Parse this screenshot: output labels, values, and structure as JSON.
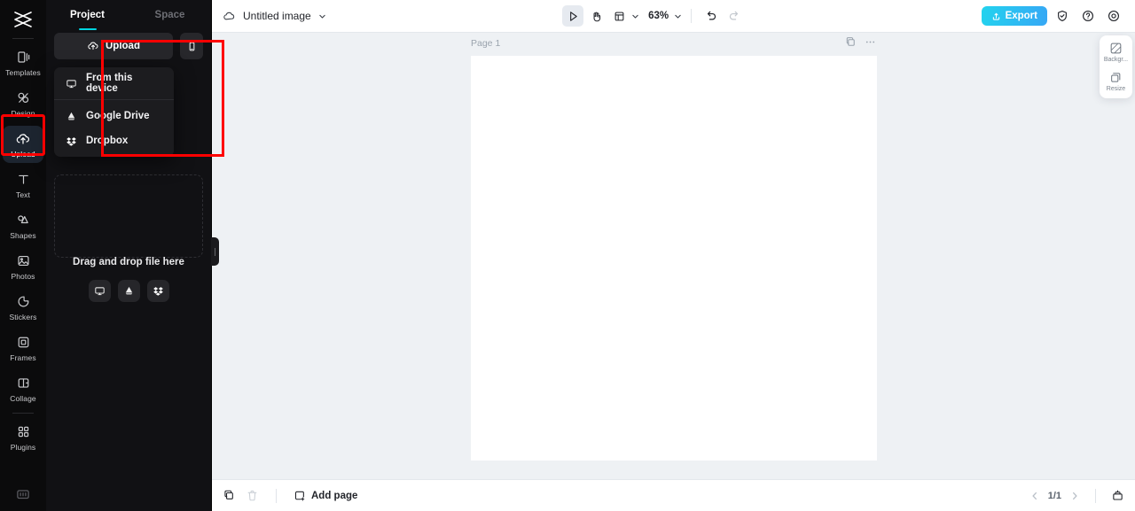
{
  "colors": {
    "rail_bg": "#0b0b0c",
    "panel_bg": "#111114",
    "accent_cyan": "#00d5e0",
    "export_from": "#23d3ee",
    "export_to": "#36a7f5",
    "highlight_red": "#ff0000",
    "canvas_bg": "#eef1f4",
    "active_item_bg": "#1d2530"
  },
  "rail": {
    "logo_name": "capcut-logo",
    "items": [
      {
        "label": "Templates",
        "icon": "templates-icon",
        "active": false
      },
      {
        "label": "Design",
        "icon": "design-icon",
        "active": false
      },
      {
        "label": "Upload",
        "icon": "upload-cloud-icon",
        "active": true
      },
      {
        "label": "Text",
        "icon": "text-icon",
        "active": false
      },
      {
        "label": "Shapes",
        "icon": "shapes-icon",
        "active": false
      },
      {
        "label": "Photos",
        "icon": "photos-icon",
        "active": false
      },
      {
        "label": "Stickers",
        "icon": "stickers-icon",
        "active": false
      },
      {
        "label": "Frames",
        "icon": "frames-icon",
        "active": false
      },
      {
        "label": "Collage",
        "icon": "collage-icon",
        "active": false
      },
      {
        "label": "Plugins",
        "icon": "plugins-icon",
        "active": false
      }
    ],
    "bottom_icon": "keyboard-icon"
  },
  "panel": {
    "tabs": [
      {
        "label": "Project",
        "active": true
      },
      {
        "label": "Space",
        "active": false
      }
    ],
    "upload_button": "Upload",
    "device_button_icon": "mobile-device-icon",
    "menu": [
      {
        "label": "From this device",
        "icon": "monitor-icon"
      },
      {
        "label": "Google Drive",
        "icon": "google-drive-icon"
      },
      {
        "label": "Dropbox",
        "icon": "dropbox-icon"
      }
    ],
    "dropzone": {
      "text": "Drag and drop file here",
      "buttons": [
        {
          "icon": "monitor-icon"
        },
        {
          "icon": "google-drive-icon"
        },
        {
          "icon": "dropbox-icon"
        }
      ]
    },
    "collapse_handle": "collapse-panel-handle"
  },
  "topbar": {
    "project_icon": "cloud-project-icon",
    "title": "Untitled image",
    "title_chevron": "chevron-down-icon",
    "tools": [
      {
        "icon": "select-cursor-icon",
        "selected": true
      },
      {
        "icon": "hand-pan-icon",
        "selected": false
      },
      {
        "icon": "fit-frame-icon",
        "selected": false
      }
    ],
    "zoom_value": "63%",
    "undo_icon": "undo-icon",
    "redo_icon": "redo-icon",
    "export_label": "Export",
    "export_icon": "export-upload-icon",
    "right_icons": [
      {
        "icon": "shield-check-icon"
      },
      {
        "icon": "help-circle-icon"
      },
      {
        "icon": "settings-gear-icon"
      }
    ]
  },
  "canvas": {
    "page_label": "Page 1",
    "page_tools": [
      {
        "icon": "duplicate-page-icon"
      },
      {
        "icon": "more-options-icon"
      }
    ]
  },
  "side_panel": [
    {
      "label": "Backgr...",
      "icon": "background-icon"
    },
    {
      "label": "Resize",
      "icon": "resize-icon"
    }
  ],
  "bottombar": {
    "duplicate_icon": "duplicate-icon",
    "delete_icon": "trash-icon",
    "add_page_label": "Add page",
    "add_page_icon": "add-page-icon",
    "prev_icon": "chevron-left-icon",
    "next_icon": "chevron-right-icon",
    "page_indicator": "1/1",
    "grid_view_icon": "page-grid-icon"
  }
}
